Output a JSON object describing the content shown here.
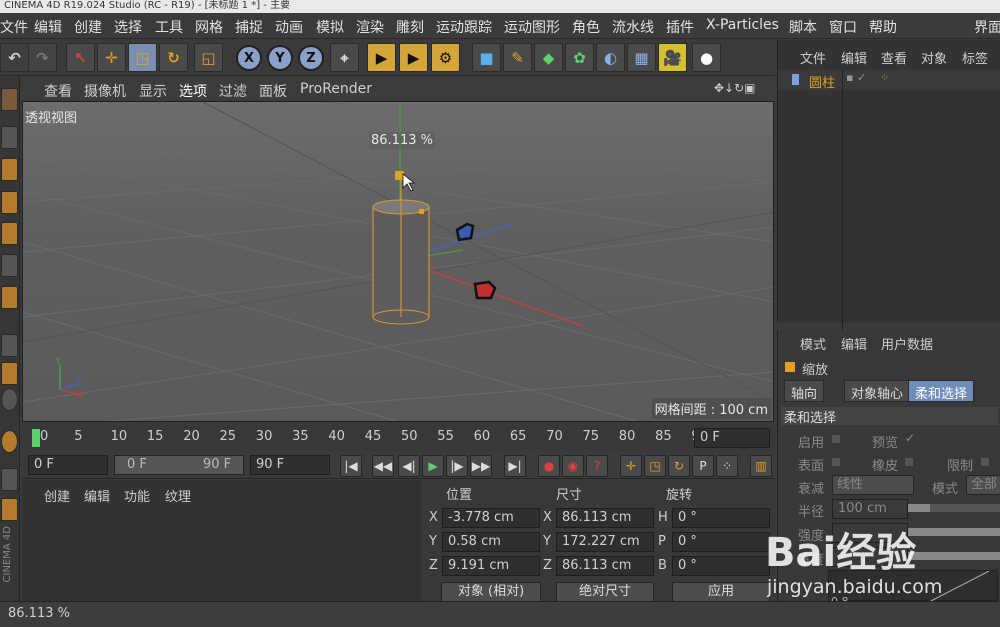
{
  "window": {
    "title": "CINEMA 4D R19.024 Studio (RC - R19) - [未标题 1 *] - 主要"
  },
  "menu": [
    "文件",
    "编辑",
    "创建",
    "选择",
    "工具",
    "网格",
    "捕捉",
    "动画",
    "模拟",
    "渲染",
    "雕刻",
    "运动跟踪",
    "运动图形",
    "角色",
    "流水线",
    "插件",
    "X-Particles",
    "脚本",
    "窗口",
    "帮助",
    "界面"
  ],
  "toolbar": {
    "axis_x": "X",
    "axis_y": "Y",
    "axis_z": "Z",
    "tools": [
      "undo-icon",
      "redo-icon",
      "select-icon",
      "move-icon",
      "scale-icon",
      "rotate-icon",
      "recent-tool-icon",
      "coordinate-system-icon",
      "render-view-icon",
      "render-picture-viewer-icon",
      "render-settings-icon",
      "cube-icon",
      "pen-icon",
      "subdivision-icon",
      "array-icon",
      "deformer-icon",
      "floor-icon",
      "camera-icon",
      "light-icon"
    ]
  },
  "viewport": {
    "menu": [
      "查看",
      "摄像机",
      "显示",
      "选项",
      "过滤",
      "面板",
      "ProRender"
    ],
    "label": "透视视图",
    "scale_readout": "86.113 %",
    "grid_spacing": "网格间距 : 100 cm"
  },
  "timeline": {
    "ticks": [
      "0",
      "5",
      "10",
      "15",
      "20",
      "25",
      "30",
      "35",
      "40",
      "45",
      "50",
      "55",
      "60",
      "65",
      "70",
      "75",
      "80",
      "85",
      "90"
    ],
    "current_frame": "0 F"
  },
  "transport": {
    "start_field": "0 F",
    "range_start": "0 F",
    "range_end": "90 F",
    "end_field": "90 F"
  },
  "material_panel": {
    "tabs": [
      "创建",
      "编辑",
      "功能",
      "纹理"
    ]
  },
  "coords": {
    "headers": [
      "位置",
      "尺寸",
      "旋转"
    ],
    "position": [
      {
        "axis": "X",
        "value": "-3.778 cm"
      },
      {
        "axis": "Y",
        "value": "0.58 cm"
      },
      {
        "axis": "Z",
        "value": "9.191 cm"
      }
    ],
    "size": [
      {
        "axis": "X",
        "value": "86.113 cm"
      },
      {
        "axis": "Y",
        "value": "172.227 cm"
      },
      {
        "axis": "Z",
        "value": "86.113 cm"
      }
    ],
    "rotation": [
      {
        "axis": "H",
        "value": "0 °"
      },
      {
        "axis": "P",
        "value": "0 °"
      },
      {
        "axis": "B",
        "value": "0 °"
      }
    ],
    "mode_dropdown": "对象 (相对)",
    "size_dropdown": "绝对尺寸",
    "apply": "应用"
  },
  "object_manager": {
    "menu": [
      "文件",
      "编辑",
      "查看",
      "对象",
      "标签"
    ],
    "objects": [
      {
        "name": "圆柱"
      }
    ]
  },
  "attributes": {
    "menu": [
      "模式",
      "编辑",
      "用户数据"
    ],
    "tool_name": "缩放",
    "tabs": [
      "轴向",
      "对象轴心",
      "柔和选择"
    ],
    "section": "柔和选择",
    "enable": "启用",
    "preview": "预览",
    "surface": "表面",
    "rubber": "橡皮",
    "restrict": "限制",
    "falloff": "衰减",
    "falloff_value": "线性",
    "mode": "模式",
    "mode_value": "全部",
    "radius": "半径",
    "radius_value": "100 cm",
    "strength": "强度",
    "width": "宽度",
    "graph_value": "0.8"
  },
  "status": {
    "text": "86.113 %"
  },
  "watermark": {
    "logo": "Bai经验",
    "url": "jingyan.baidu.com"
  },
  "colors": {
    "selection": "#d6a728",
    "accent": "#6f8db8"
  }
}
